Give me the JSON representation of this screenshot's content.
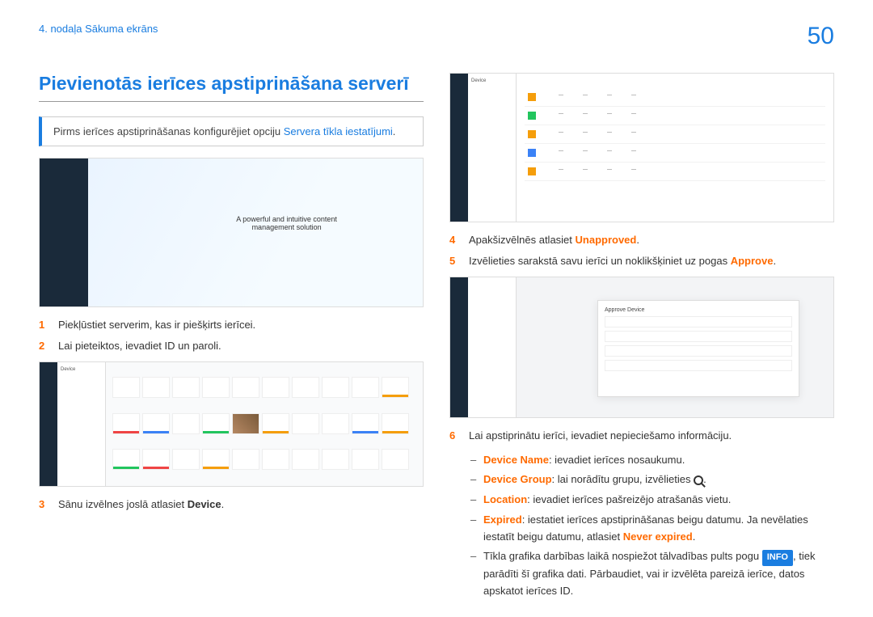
{
  "header": {
    "breadcrumb": "4. nodaļa Sākuma ekrāns",
    "page_number": "50"
  },
  "left": {
    "title": "Pievienotās ierīces apstiprināšana serverī",
    "note_prefix": "Pirms ierīces apstiprināšanas konfigurējiet opciju ",
    "note_link": "Servera tīkla iestatījumi",
    "note_suffix": ".",
    "steps": {
      "s1": {
        "num": "1",
        "text": "Piekļūstiet serverim, kas ir piešķirts ierīcei."
      },
      "s2": {
        "num": "2",
        "text": "Lai pieteiktos, ievadiet ID un paroli."
      },
      "s3": {
        "num": "3",
        "text_pre": "Sānu izvēlnes joslā atlasiet ",
        "highlight": "Device",
        "text_post": "."
      }
    },
    "ss2_panel_title": "Device"
  },
  "right": {
    "steps": {
      "s4": {
        "num": "4",
        "text_pre": "Apakšizvēlnēs atlasiet ",
        "highlight": "Unapproved",
        "text_post": "."
      },
      "s5": {
        "num": "5",
        "text_pre": "Izvēlieties sarakstā savu ierīci un noklikšķiniet uz pogas ",
        "highlight": "Approve",
        "text_post": "."
      },
      "s6": {
        "num": "6",
        "text": "Lai apstiprinātu ierīci, ievadiet nepieciešamo informāciju."
      }
    },
    "sub": {
      "a": {
        "label": "Device Name",
        "text": ": ievadiet ierīces nosaukumu."
      },
      "b": {
        "label": "Device Group",
        "text": ": lai norādītu grupu, izvēlieties "
      },
      "c": {
        "label": "Location",
        "text": ": ievadiet ierīces pašreizējo atrašanās vietu."
      },
      "d": {
        "label": "Expired",
        "text_pre": ": iestatiet ierīces apstiprināšanas beigu datumu. Ja nevēlaties iestatīt beigu datumu, atlasiet ",
        "highlight": "Never expired",
        "text_post": "."
      },
      "e": {
        "text_pre": "Tīkla grafika darbības laikā nospiežot tālvadības pults pogu ",
        "pill": "INFO",
        "text_post": ", tiek parādīti šī grafika dati. Pārbaudiet, vai ir izvēlēta pareizā ierīce, datos apskatot ierīces ID."
      }
    },
    "ss3_panel_title": "Device",
    "ss4_modal_title": "Approve Device"
  }
}
